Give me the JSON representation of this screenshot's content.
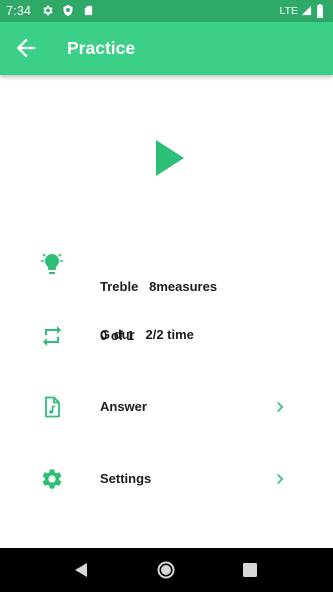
{
  "status_bar": {
    "time": "7:34",
    "network": "LTE"
  },
  "app_bar": {
    "title": "Practice"
  },
  "colors": {
    "accent": "#3ccf87",
    "status_bar": "#2fa968",
    "icon": "#2ebf76"
  },
  "info": {
    "line1": "Treble   8measures",
    "line2": "G dur   2/2 time"
  },
  "progress": {
    "label": "0 of 1"
  },
  "menu": {
    "answer_label": "Answer",
    "settings_label": "Settings"
  },
  "icons": {
    "info": "lightbulb-icon",
    "progress": "repeat-icon",
    "answer": "music-file-icon",
    "settings": "gear-icon",
    "play": "play-icon"
  }
}
